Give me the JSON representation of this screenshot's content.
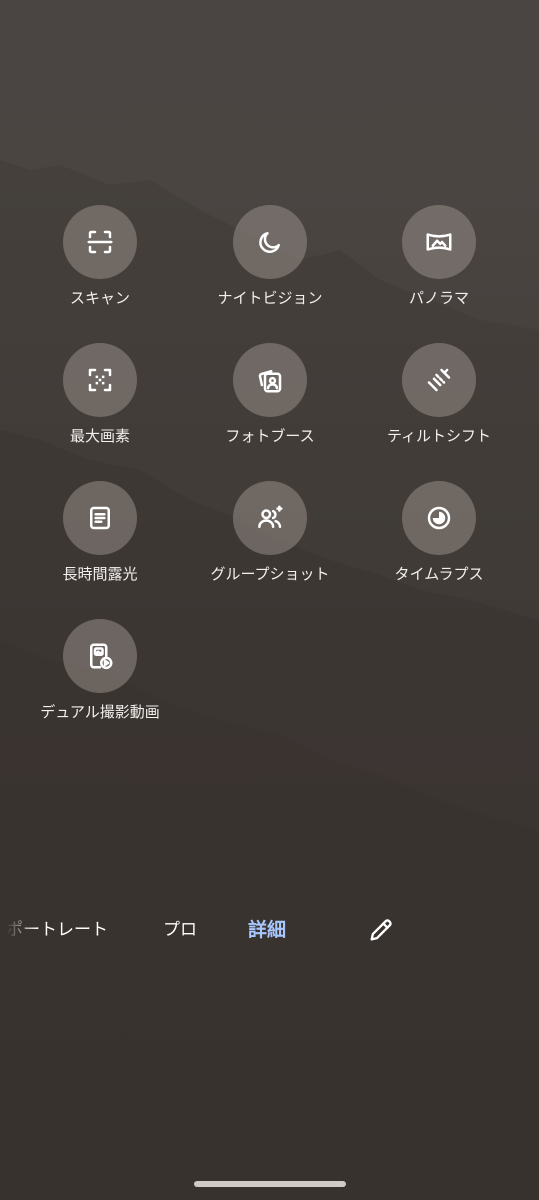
{
  "colors": {
    "active_tab": "#a9c7ff",
    "icon_circle": "#8a817c",
    "text": "#ffffff"
  },
  "modes": [
    {
      "label": "スキャン",
      "icon": "scan-icon"
    },
    {
      "label": "ナイトビジョン",
      "icon": "moon-icon"
    },
    {
      "label": "パノラマ",
      "icon": "panorama-icon"
    },
    {
      "label": "最大画素",
      "icon": "max-pixel-icon"
    },
    {
      "label": "フォトブース",
      "icon": "photo-booth-icon"
    },
    {
      "label": "ティルトシフト",
      "icon": "tilt-shift-icon"
    },
    {
      "label": "長時間露光",
      "icon": "long-exposure-icon"
    },
    {
      "label": "グループショット",
      "icon": "group-shot-icon"
    },
    {
      "label": "タイムラプス",
      "icon": "timelapse-icon"
    },
    {
      "label": "デュアル撮影動画",
      "icon": "dual-video-icon"
    }
  ],
  "tabs": {
    "portrait": "ポートレート",
    "pro": "プロ",
    "more": "詳細"
  },
  "edit_icon": "pencil-icon"
}
